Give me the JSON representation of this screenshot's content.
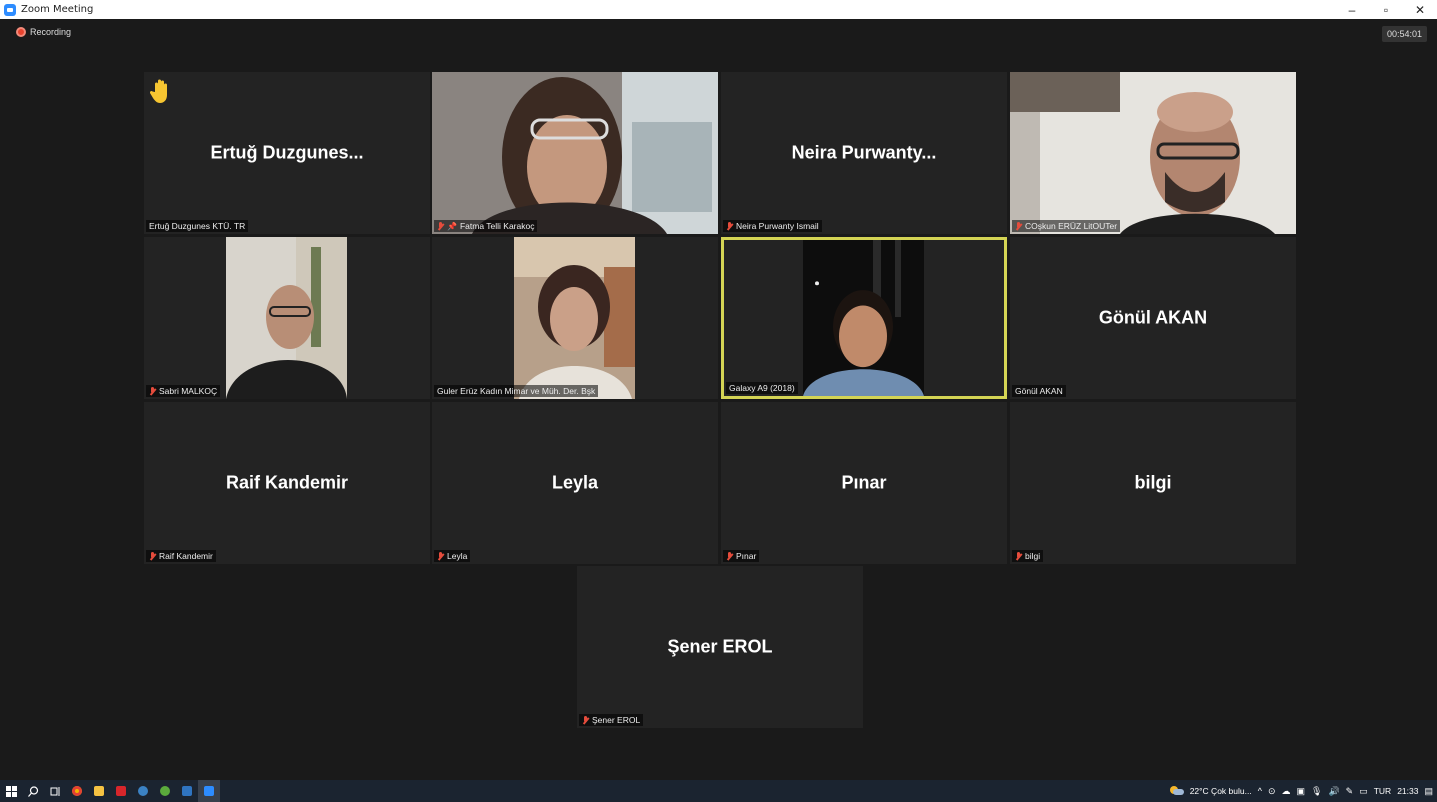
{
  "window": {
    "title": "Zoom Meeting",
    "controls": {
      "minimize": "–",
      "maximize": "▫",
      "close": "✕"
    }
  },
  "meeting": {
    "recording_label": "Recording",
    "elapsed_time": "00:54:01"
  },
  "participants": [
    {
      "display_name": "Ertuğ  Duzgunes...",
      "label": "Ertuğ Duzgunes KTÜ. TR",
      "muted": false,
      "hand_raised": true,
      "video": false
    },
    {
      "display_name": "",
      "label": "Fatma Telli Karakoç",
      "muted": true,
      "pinned": true,
      "video": true
    },
    {
      "display_name": "Neira  Purwanty...",
      "label": "Neira Purwanty Ismail",
      "muted": true,
      "video": false
    },
    {
      "display_name": "",
      "label": "COşkun ERÜZ LitOUTer",
      "muted": true,
      "video": true
    },
    {
      "display_name": "",
      "label": "Sabri MALKOÇ",
      "muted": true,
      "video": true
    },
    {
      "display_name": "",
      "label": "Guler Erüz Kadın Mimar ve Müh. Der. Bşk",
      "muted": false,
      "video": true
    },
    {
      "display_name": "",
      "label": "Galaxy A9 (2018)",
      "muted": false,
      "video": true,
      "active_speaker": true
    },
    {
      "display_name": "Gönül AKAN",
      "label": "Gönül AKAN",
      "muted": false,
      "video": false
    },
    {
      "display_name": "Raif Kandemir",
      "label": "Raif Kandemir",
      "muted": true,
      "video": false
    },
    {
      "display_name": "Leyla",
      "label": "Leyla",
      "muted": true,
      "video": false
    },
    {
      "display_name": "Pınar",
      "label": "Pınar",
      "muted": true,
      "video": false
    },
    {
      "display_name": "bilgi",
      "label": "bilgi",
      "muted": true,
      "video": false
    },
    {
      "display_name": "Şener EROL",
      "label": "Şener EROL",
      "muted": true,
      "video": false
    }
  ],
  "taskbar": {
    "weather": "22°C  Çok bulu...",
    "language": "TUR",
    "clock": "21:33"
  },
  "colors": {
    "background": "#1a1a1a",
    "tile": "#232323",
    "active_speaker_border": "#d4d454",
    "muted_mic": "#e54c3c",
    "zoom_blue": "#2d8cff",
    "taskbar": "#1b2430"
  }
}
